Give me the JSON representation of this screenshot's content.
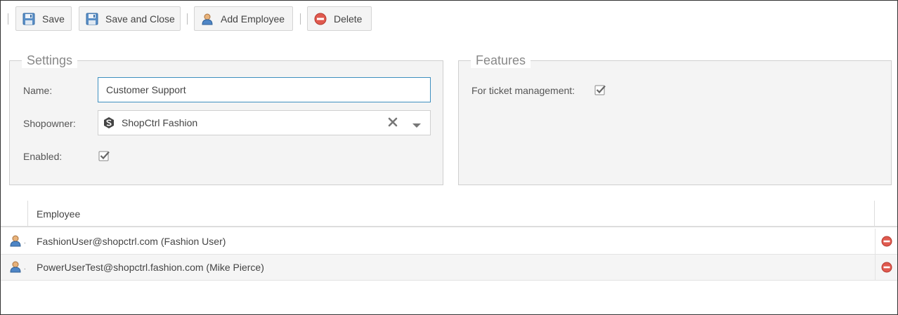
{
  "toolbar": {
    "save_label": "Save",
    "save_close_label": "Save and Close",
    "add_employee_label": "Add Employee",
    "delete_label": "Delete"
  },
  "settings": {
    "legend": "Settings",
    "name_label": "Name:",
    "name_value": "Customer Support",
    "shopowner_label": "Shopowner:",
    "shopowner_value": "ShopCtrl Fashion",
    "enabled_label": "Enabled:",
    "enabled_checked": true
  },
  "features": {
    "legend": "Features",
    "ticket_label": "For ticket management:",
    "ticket_checked": true
  },
  "grid": {
    "column_employee": "Employee",
    "rows": [
      {
        "employee": "FashionUser@shopctrl.com (Fashion User)"
      },
      {
        "employee": "PowerUserTest@shopctrl.fashion.com (Mike Pierce)"
      }
    ]
  },
  "colors": {
    "accent_border": "#3d8fbf",
    "panel_bg": "#f4f4f4",
    "delete_red": "#e05a4f"
  },
  "icons": {
    "save": "floppy-disk-icon",
    "add_employee": "user-icon",
    "delete": "minus-circle-icon",
    "shopowner": "shopctrl-logo-icon",
    "clear": "clear-x-icon",
    "dropdown": "chevron-down-icon"
  }
}
